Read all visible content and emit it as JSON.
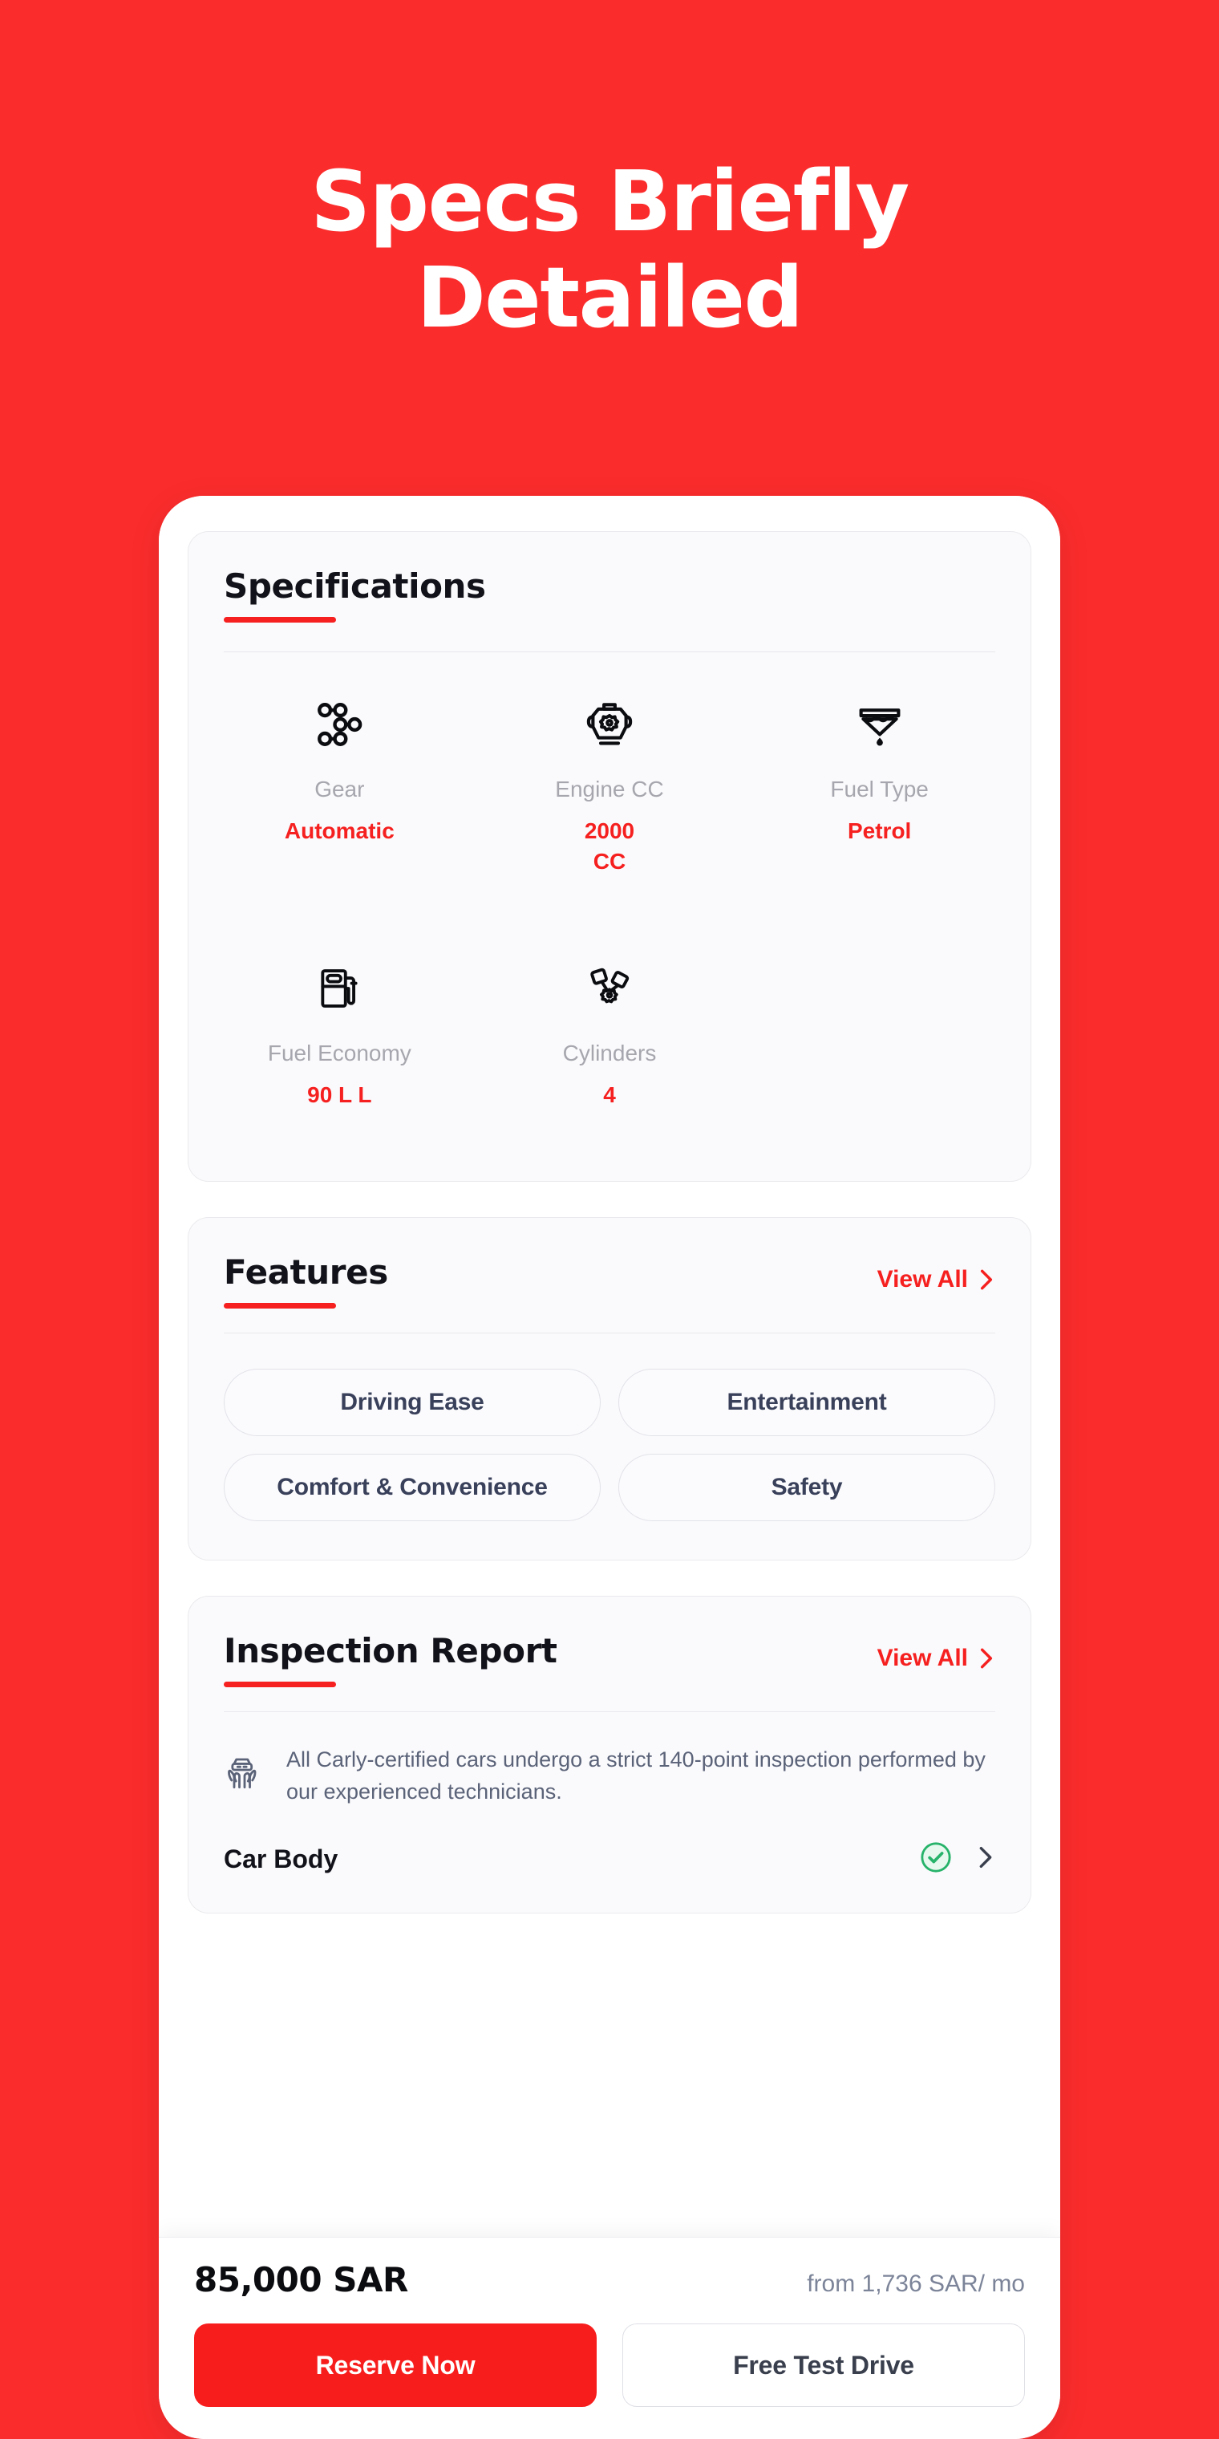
{
  "hero": {
    "title_line1": "Specs Briefly",
    "title_line2": "Detailed"
  },
  "colors": {
    "background": "#FB2C2C",
    "accent": "#F5201F",
    "primary_button": "#F81D1D",
    "heading": "#12131A",
    "muted_label": "#A6A6AE",
    "chip_text": "#39405A",
    "note_text": "#5B6379",
    "check_green": "#27B36A"
  },
  "specifications": {
    "title": "Specifications",
    "items": [
      {
        "icon": "gear-shift-icon",
        "label": "Gear",
        "value": "Automatic"
      },
      {
        "icon": "engine-icon",
        "label": "Engine CC",
        "value": "2000 CC"
      },
      {
        "icon": "fuel-funnel-icon",
        "label": "Fuel Type",
        "value": "Petrol"
      },
      {
        "icon": "fuel-pump-icon",
        "label": "Fuel Economy",
        "value": "90 L L"
      },
      {
        "icon": "pistons-icon",
        "label": "Cylinders",
        "value": "4"
      }
    ]
  },
  "features": {
    "title": "Features",
    "view_all_label": "View All",
    "chips": [
      "Driving Ease",
      "Entertainment",
      "Comfort & Convenience",
      "Safety"
    ]
  },
  "inspection": {
    "title": "Inspection Report",
    "view_all_label": "View All",
    "note": "All Carly-certified cars undergo a strict 140-point inspection performed by our experienced technicians.",
    "rows": [
      {
        "name": "Car Body",
        "status": "passed"
      }
    ]
  },
  "bottom_bar": {
    "price": "85,000 SAR",
    "finance": "from 1,736 SAR/ mo",
    "primary_cta": "Reserve Now",
    "secondary_cta": "Free Test Drive"
  }
}
